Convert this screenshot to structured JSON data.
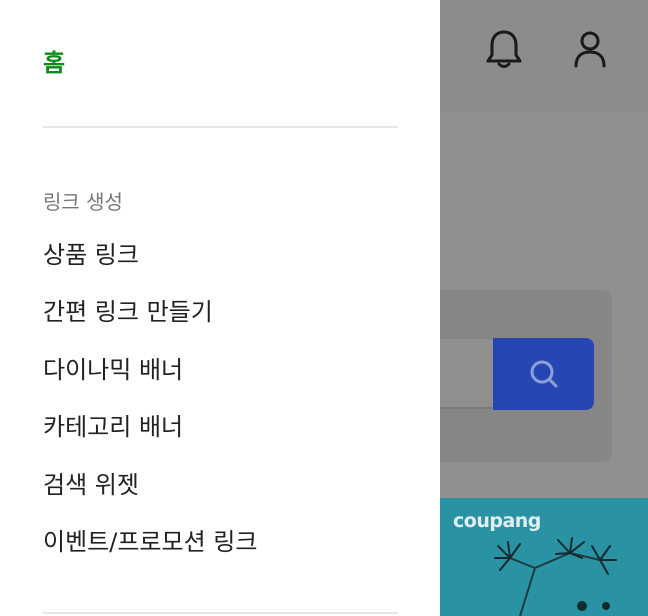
{
  "drawer": {
    "home_label": "홈",
    "section_label": "링크 생성",
    "items": [
      {
        "label": "상품 링크"
      },
      {
        "label": "간편 링크 만들기"
      },
      {
        "label": "다이나믹 배너"
      },
      {
        "label": "카테고리 배너"
      },
      {
        "label": "검색 위젯"
      },
      {
        "label": "이벤트/프로모션 링크"
      }
    ]
  },
  "background": {
    "header_icons": [
      "bell-icon",
      "user-icon"
    ],
    "search_button_icon": "search-icon",
    "banner_logo": "coupang"
  },
  "colors": {
    "home_active": "#0c8a1d",
    "search_button": "#2546b3",
    "banner": "#2a93a3",
    "overlay": "#8f8f8f"
  }
}
